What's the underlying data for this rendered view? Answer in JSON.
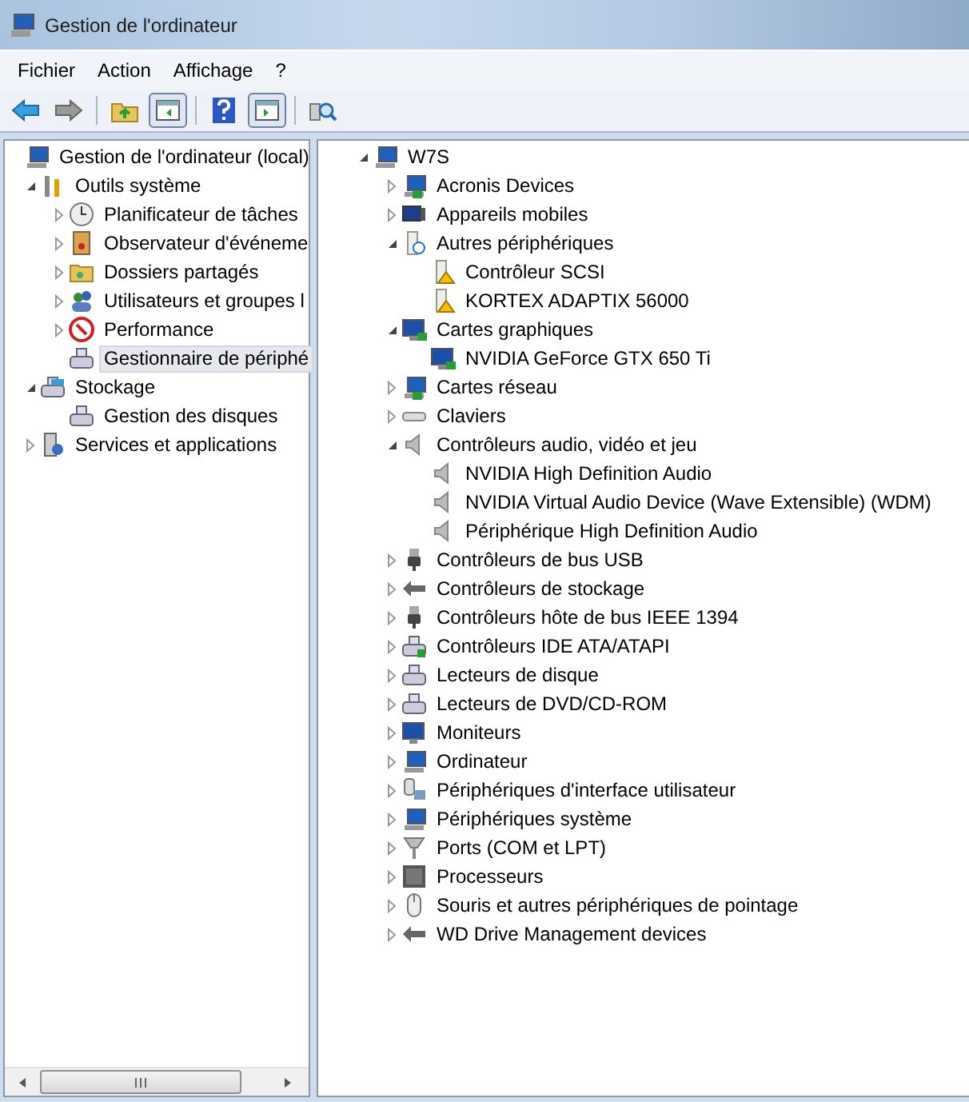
{
  "window": {
    "title": "Gestion de l'ordinateur"
  },
  "menu": [
    "Fichier",
    "Action",
    "Affichage",
    "?"
  ],
  "toolbar": [
    {
      "kind": "back"
    },
    {
      "kind": "forward"
    },
    {
      "kind": "sep"
    },
    {
      "kind": "up"
    },
    {
      "kind": "panel-left"
    },
    {
      "kind": "sep"
    },
    {
      "kind": "help"
    },
    {
      "kind": "panel-right"
    },
    {
      "kind": "sep"
    },
    {
      "kind": "scan"
    }
  ],
  "sidebar": {
    "items": [
      {
        "label": "Gestion de l'ordinateur (local)",
        "kind": "computer",
        "selected": false,
        "children": [
          {
            "label": "Outils système",
            "kind": "tools",
            "expanded": true,
            "selected": false,
            "children": [
              {
                "label": "Planificateur de tâches",
                "kind": "clock",
                "expanded": false,
                "selected": false
              },
              {
                "label": "Observateur d'événeme",
                "kind": "log",
                "expanded": false,
                "selected": false
              },
              {
                "label": "Dossiers partagés",
                "kind": "folder",
                "expanded": false,
                "selected": false
              },
              {
                "label": "Utilisateurs et groupes l",
                "kind": "users",
                "expanded": false,
                "selected": false
              },
              {
                "label": "Performance",
                "kind": "perf",
                "expanded": false,
                "selected": false
              },
              {
                "label": "Gestionnaire de périphé",
                "kind": "devices",
                "selected": true
              }
            ]
          },
          {
            "label": "Stockage",
            "kind": "storage",
            "expanded": true,
            "selected": false,
            "children": [
              {
                "label": "Gestion des disques",
                "kind": "disk",
                "selected": false
              }
            ]
          },
          {
            "label": "Services et applications",
            "kind": "services",
            "expanded": false,
            "selected": false
          }
        ]
      }
    ]
  },
  "device_tree": {
    "items": [
      {
        "label": "W7S",
        "kind": "computer",
        "expanded": true,
        "children": [
          {
            "label": "Acronis Devices",
            "kind": "network",
            "expanded": false
          },
          {
            "label": "Appareils mobiles",
            "kind": "mobile",
            "expanded": false
          },
          {
            "label": "Autres périphériques",
            "kind": "unknown",
            "expanded": true,
            "children": [
              {
                "label": "Contrôleur SCSI",
                "kind": "warning"
              },
              {
                "label": "KORTEX ADAPTIX 56000",
                "kind": "warning"
              }
            ]
          },
          {
            "label": "Cartes graphiques",
            "kind": "display",
            "expanded": true,
            "children": [
              {
                "label": "NVIDIA GeForce GTX 650 Ti",
                "kind": "display"
              }
            ]
          },
          {
            "label": "Cartes réseau",
            "kind": "network",
            "expanded": false
          },
          {
            "label": "Claviers",
            "kind": "keyboard",
            "expanded": false
          },
          {
            "label": "Contrôleurs audio, vidéo et jeu",
            "kind": "audio",
            "expanded": true,
            "children": [
              {
                "label": "NVIDIA High Definition Audio",
                "kind": "audio"
              },
              {
                "label": "NVIDIA Virtual Audio Device (Wave Extensible) (WDM)",
                "kind": "audio"
              },
              {
                "label": "Périphérique High Definition Audio",
                "kind": "audio"
              }
            ]
          },
          {
            "label": "Contrôleurs de bus USB",
            "kind": "usb",
            "expanded": false
          },
          {
            "label": "Contrôleurs de stockage",
            "kind": "storage-ctl",
            "expanded": false
          },
          {
            "label": "Contrôleurs hôte de bus IEEE 1394",
            "kind": "usb",
            "expanded": false
          },
          {
            "label": "Contrôleurs IDE ATA/ATAPI",
            "kind": "ide",
            "expanded": false
          },
          {
            "label": "Lecteurs de disque",
            "kind": "drive",
            "expanded": false
          },
          {
            "label": "Lecteurs de DVD/CD-ROM",
            "kind": "dvd",
            "expanded": false
          },
          {
            "label": "Moniteurs",
            "kind": "monitor",
            "expanded": false
          },
          {
            "label": "Ordinateur",
            "kind": "pc",
            "expanded": false
          },
          {
            "label": "Périphériques d'interface utilisateur",
            "kind": "hid",
            "expanded": false
          },
          {
            "label": "Périphériques système",
            "kind": "pc",
            "expanded": false
          },
          {
            "label": "Ports (COM et LPT)",
            "kind": "port",
            "expanded": false
          },
          {
            "label": "Processeurs",
            "kind": "cpu",
            "expanded": false
          },
          {
            "label": "Souris et autres périphériques de pointage",
            "kind": "mouse",
            "expanded": false
          },
          {
            "label": "WD Drive Management devices",
            "kind": "storage-ctl",
            "expanded": false
          }
        ]
      }
    ]
  }
}
